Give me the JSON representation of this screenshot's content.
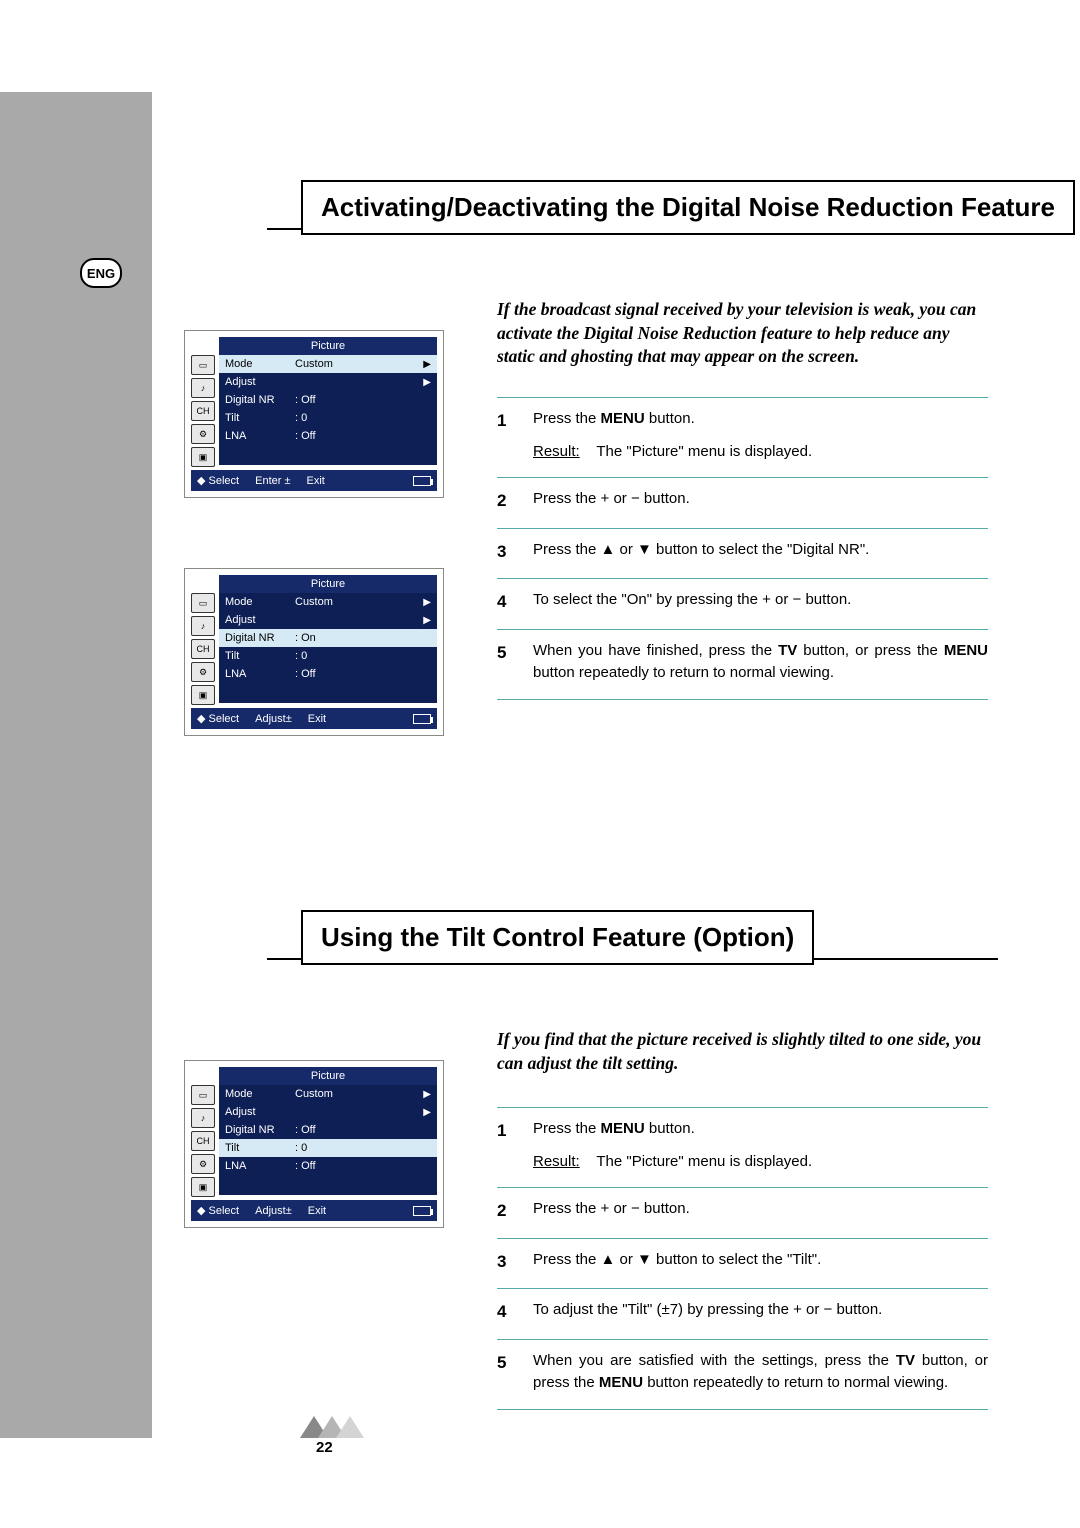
{
  "badge": {
    "lang": "ENG"
  },
  "section1": {
    "title": "Activating/Deactivating the Digital Noise Reduction Feature",
    "intro": "If the broadcast signal received by your television is weak, you can activate the Digital Noise Reduction feature to help reduce any static and ghosting that may appear on the screen.",
    "steps": [
      {
        "n": "1",
        "body_pre": "Press the ",
        "bold": "MENU",
        "body_post": " button.",
        "result_lbl": "Result:",
        "result_txt": "The \"Picture\" menu is displayed."
      },
      {
        "n": "2",
        "body": "Press the + or − button."
      },
      {
        "n": "3",
        "body": "Press the ▲ or ▼ button to select the \"Digital NR\"."
      },
      {
        "n": "4",
        "body": "To select the \"On\" by pressing the + or − button."
      },
      {
        "n": "5",
        "body_pre": "When you have finished, press the ",
        "bold1": "TV",
        "mid": " button, or press the ",
        "bold2": "MENU",
        "body_post": " button repeatedly to return to normal viewing."
      }
    ]
  },
  "section2": {
    "title": "Using the Tilt Control Feature (Option)",
    "intro": "If you find that the picture received is slightly tilted to one side, you can adjust the tilt setting.",
    "steps": [
      {
        "n": "1",
        "body_pre": "Press the ",
        "bold": "MENU",
        "body_post": " button.",
        "result_lbl": "Result:",
        "result_txt": "The \"Picture\" menu is displayed."
      },
      {
        "n": "2",
        "body": "Press the + or − button."
      },
      {
        "n": "3",
        "body": "Press the ▲ or ▼ button to select the \"Tilt\"."
      },
      {
        "n": "4",
        "body": "To adjust the \"Tilt\" (±7) by pressing the + or − button."
      },
      {
        "n": "5",
        "body_pre": "When you are satisfied with the settings, press the ",
        "bold1": "TV",
        "mid": " button, or press the ",
        "bold2": "MENU",
        "body_post": " button repeatedly to return to normal viewing."
      }
    ]
  },
  "osd_common": {
    "title": "Picture",
    "mode_lbl": "Mode",
    "mode_val": "Custom",
    "adjust_lbl": "Adjust",
    "dnr_lbl": "Digital NR",
    "tilt_lbl": "Tilt",
    "tilt_val": ": 0",
    "lna_lbl": "LNA",
    "lna_val": ": Off",
    "ft_select": "Select",
    "ft_enter": "Enter",
    "ft_adjust": "Adjust",
    "ft_exit": "Exit",
    "arrow_r": "▶",
    "arrow_ud": "◆",
    "pm": "±"
  },
  "osd1": {
    "dnr_val": ": Off",
    "hl": "mode"
  },
  "osd2": {
    "dnr_val": ": On",
    "hl": "dnr"
  },
  "osd3": {
    "dnr_val": ": Off",
    "hl": "tilt"
  },
  "page_number": "22"
}
